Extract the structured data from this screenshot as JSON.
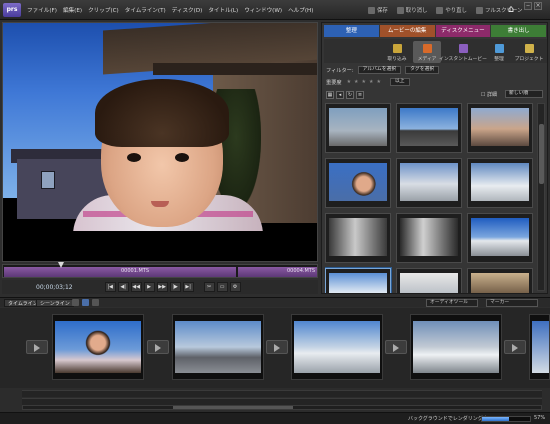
{
  "app": {
    "logo_text": "prs"
  },
  "menu": [
    "ファイル(F)",
    "編集(E)",
    "クリップ(C)",
    "タイムライン(T)",
    "ディスク(D)",
    "タイトル(L)",
    "ウィンドウ(W)",
    "ヘルプ(H)"
  ],
  "toolbar": {
    "save": "保存",
    "undo": "取り消し",
    "redo": "やり直し",
    "fullscreen": "フルスクリーン"
  },
  "monitor": {
    "clip1": "00001.MTS",
    "clip2": "00004.MTS",
    "timecode": "00;00;03;12"
  },
  "tabs": [
    "整理",
    "ムービーの編集",
    "ディスクメニュー",
    "書き出し"
  ],
  "subtools": [
    "取り込み",
    "メディア",
    "インスタントムービー",
    "整理",
    "プロジェクト"
  ],
  "filter": {
    "label": "フィルター:",
    "album": "アルバムを選択",
    "tag": "タグを選択"
  },
  "rating": {
    "label": "重要度",
    "stars": "★★★★★",
    "value": "以上"
  },
  "view": {
    "detail": "詳細",
    "sort": "新しい順"
  },
  "timeline": {
    "tab_timeline": "タイムライン",
    "tab_scene": "シーンライン",
    "audio_tool": "オーディオツール",
    "marker": "マーカー"
  },
  "status": {
    "text": "バックグラウンドでレンダリング中...",
    "percent": "57%",
    "progress_fraction": 0.57
  },
  "colors": {
    "tab_organize": "#2d61b4",
    "tab_edit": "#a0512a",
    "tab_disc": "#8d2a6a",
    "tab_share": "#3d7d36",
    "clip_purple": "#8a5aa3"
  }
}
